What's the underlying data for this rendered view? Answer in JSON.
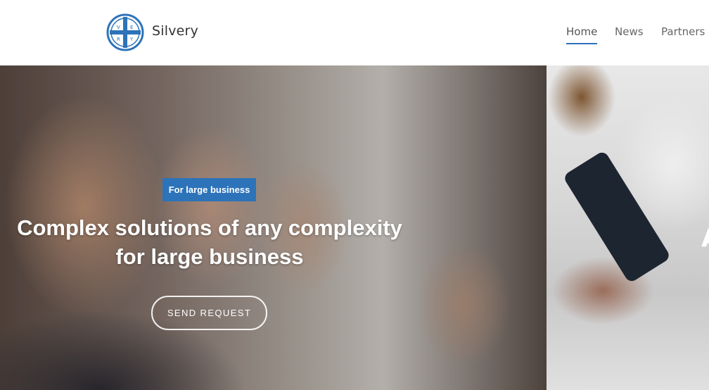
{
  "header": {
    "brand": "Silvery",
    "logo_letters": [
      "V",
      "E",
      "R",
      "Y"
    ],
    "nav": [
      {
        "label": "Home",
        "active": true
      },
      {
        "label": "News",
        "active": false
      },
      {
        "label": "Partners",
        "active": false
      }
    ]
  },
  "hero": {
    "badge": "For large business",
    "title_line1": "Complex solutions of any complexity",
    "title_line2": "for large business",
    "button": "SEND REQUEST",
    "next_slide_glyph": "A"
  },
  "colors": {
    "accent": "#2d73b9",
    "text": "#333333",
    "nav_text": "#666666"
  }
}
